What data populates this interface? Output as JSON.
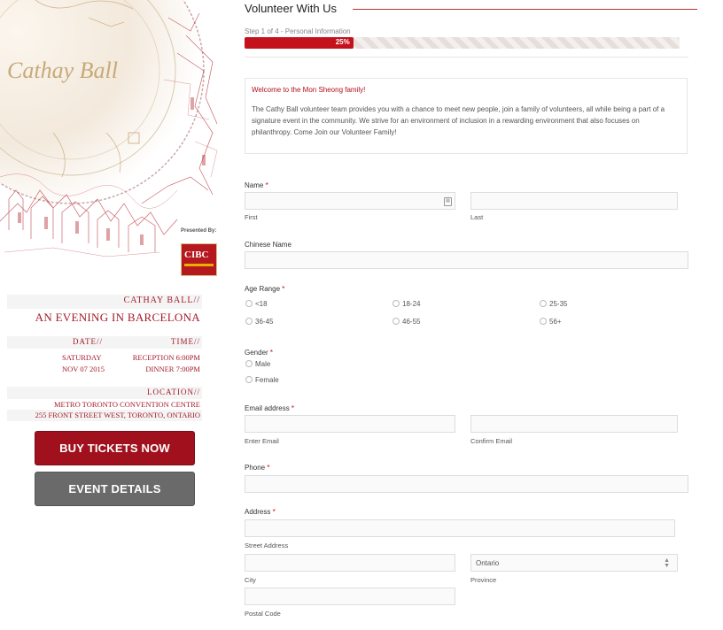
{
  "sidebar": {
    "art_title": "Cathay Ball",
    "presented_by": "Presented By:",
    "sponsor_logo_text": "CIBC",
    "event_label": "CATHAY BALL//",
    "event_name": "AN EVENING IN BARCELONA",
    "date_label": "DATE//",
    "time_label": "TIME//",
    "date_day": "SATURDAY",
    "date_value": "NOV 07 2015",
    "time_reception": "RECEPTION 6:00PM",
    "time_dinner": "DINNER 7:00PM",
    "location_label": "LOCATION//",
    "venue": "METRO TORONTO CONVENTION CENTRE",
    "address": "255 FRONT STREET WEST, TORONTO, ONTARIO",
    "buy_button": "BUY TICKETS NOW",
    "details_button": "EVENT DETAILS"
  },
  "form": {
    "title": "Volunteer With Us",
    "step_text": "Step 1 of 4 - Personal Information",
    "progress_percent": 25,
    "progress_label": "25%",
    "welcome_title": "Welcome to the Mon Sheong family!",
    "welcome_body": "The Cathy Ball volunteer team provides you with a chance to meet new people, join a family of volunteers, all while being a part of a signature event in the community. We strive for an environment of inclusion in a rewarding environment that also focuses on philanthropy. Come Join our Volunteer Family!",
    "required_mark": "*",
    "name_label": "Name",
    "first_sub": "First",
    "last_sub": "Last",
    "chinese_name_label": "Chinese Name",
    "age_label": "Age Range",
    "age_options": [
      "<18",
      "18-24",
      "25-35",
      "36-45",
      "46-55",
      "56+"
    ],
    "gender_label": "Gender",
    "gender_options": [
      "Male",
      "Female"
    ],
    "email_label": "Email address",
    "enter_email_sub": "Enter Email",
    "confirm_email_sub": "Confirm Email",
    "phone_label": "Phone",
    "address_label": "Address",
    "street_sub": "Street Address",
    "city_sub": "City",
    "province_sub": "Province",
    "province_value": "Ontario",
    "postal_sub": "Postal Code"
  },
  "colors": {
    "accent": "#a0111d",
    "progress": "#c3121b",
    "secondary_button": "#6a6a6a"
  }
}
